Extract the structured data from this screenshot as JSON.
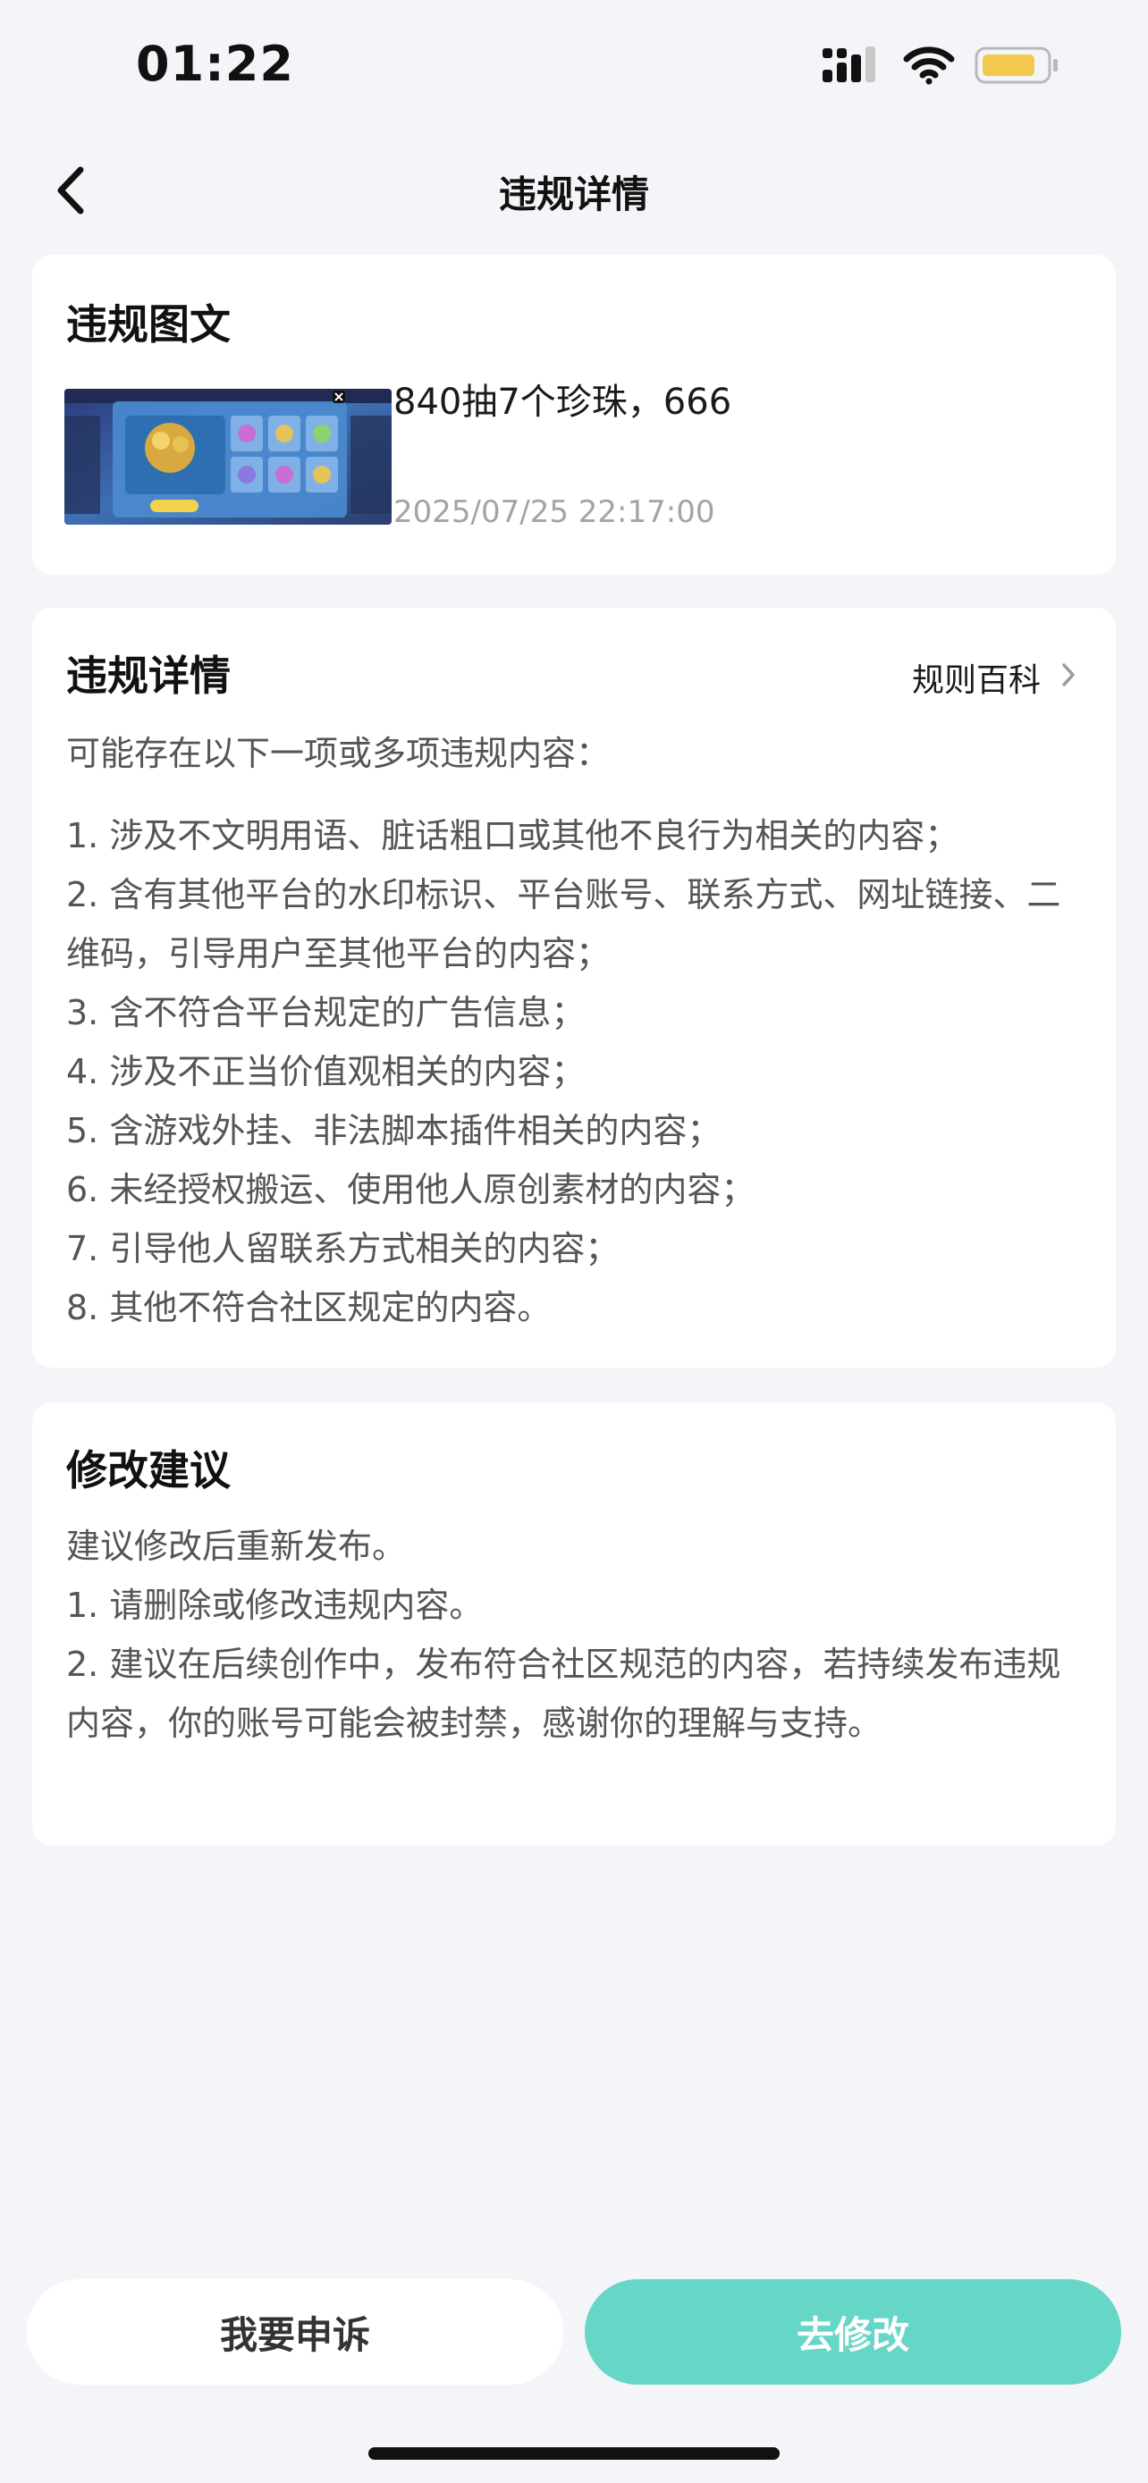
{
  "status_bar": {
    "time": "01:22",
    "icons": [
      "signal-icon",
      "wifi-icon",
      "battery-icon"
    ]
  },
  "nav": {
    "title": "违规详情",
    "back_icon": "chevron-left-icon"
  },
  "post_card": {
    "title": "违规图文",
    "post_title": "840抽7个珍珠，666",
    "post_time": "2025/07/25 22:17:00"
  },
  "detail_card": {
    "title": "违规详情",
    "rules_link": "规则百科",
    "intro": "可能存在以下一项或多项违规内容：",
    "items": [
      "1. 涉及不文明用语、脏话粗口或其他不良行为相关的内容；",
      "2. 含有其他平台的水印标识、平台账号、联系方式、网址链接、二维码，引导用户至其他平台的内容；",
      "3. 含不符合平台规定的广告信息；",
      "4. 涉及不正当价值观相关的内容；",
      "5. 含游戏外挂、非法脚本插件相关的内容；",
      "6. 未经授权搬运、使用他人原创素材的内容；",
      "7. 引导他人留联系方式相关的内容；",
      "8. 其他不符合社区规定的内容。"
    ]
  },
  "suggest_card": {
    "title": "修改建议",
    "lines": [
      "建议修改后重新发布。",
      "1. 请删除或修改违规内容。",
      "2. 建议在后续创作中，发布符合社区规范的内容，若持续发布违规内容，你的账号可能会被封禁，感谢你的理解与支持。"
    ]
  },
  "actions": {
    "appeal": "我要申诉",
    "modify": "去修改"
  },
  "colors": {
    "accent": "#66d6c6",
    "background": "#f4f5f8",
    "battery": "#f2c94c"
  }
}
